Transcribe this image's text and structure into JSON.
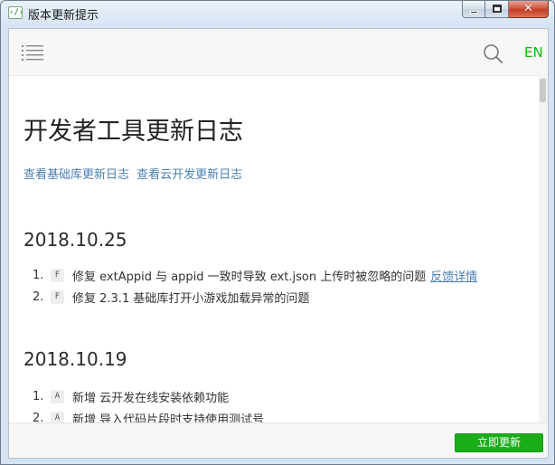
{
  "window": {
    "title": "版本更新提示",
    "app_icon_glyph": "‹/›",
    "controls": {
      "minimize": "minimize",
      "maximize": "maximize",
      "close": "✕"
    }
  },
  "header": {
    "menu_icon": "list-icon",
    "search_icon": "search-icon",
    "lang_toggle": "EN",
    "accent_color": "#09bb07"
  },
  "main": {
    "title": "开发者工具更新日志",
    "links": [
      {
        "label": "查看基础库更新日志"
      },
      {
        "label": "查看云开发更新日志"
      }
    ],
    "sections": [
      {
        "date": "2018.10.25",
        "items": [
          {
            "num": "1.",
            "tag": "F",
            "text": "修复 extAppid 与 appid 一致时导致 ext.json 上传时被忽略的问题",
            "link": "反馈详情"
          },
          {
            "num": "2.",
            "tag": "F",
            "text": "修复 2.3.1 基础库打开小游戏加载异常的问题",
            "link": ""
          }
        ]
      },
      {
        "date": "2018.10.19",
        "items": [
          {
            "num": "1.",
            "tag": "A",
            "text": "新增 云开发在线安装依赖功能",
            "link": ""
          },
          {
            "num": "2.",
            "tag": "A",
            "text": "新增 导入代码片段时支持使用测试号",
            "link": ""
          }
        ]
      }
    ]
  },
  "footer": {
    "update_button": "立即更新",
    "button_color": "#1aad19"
  }
}
